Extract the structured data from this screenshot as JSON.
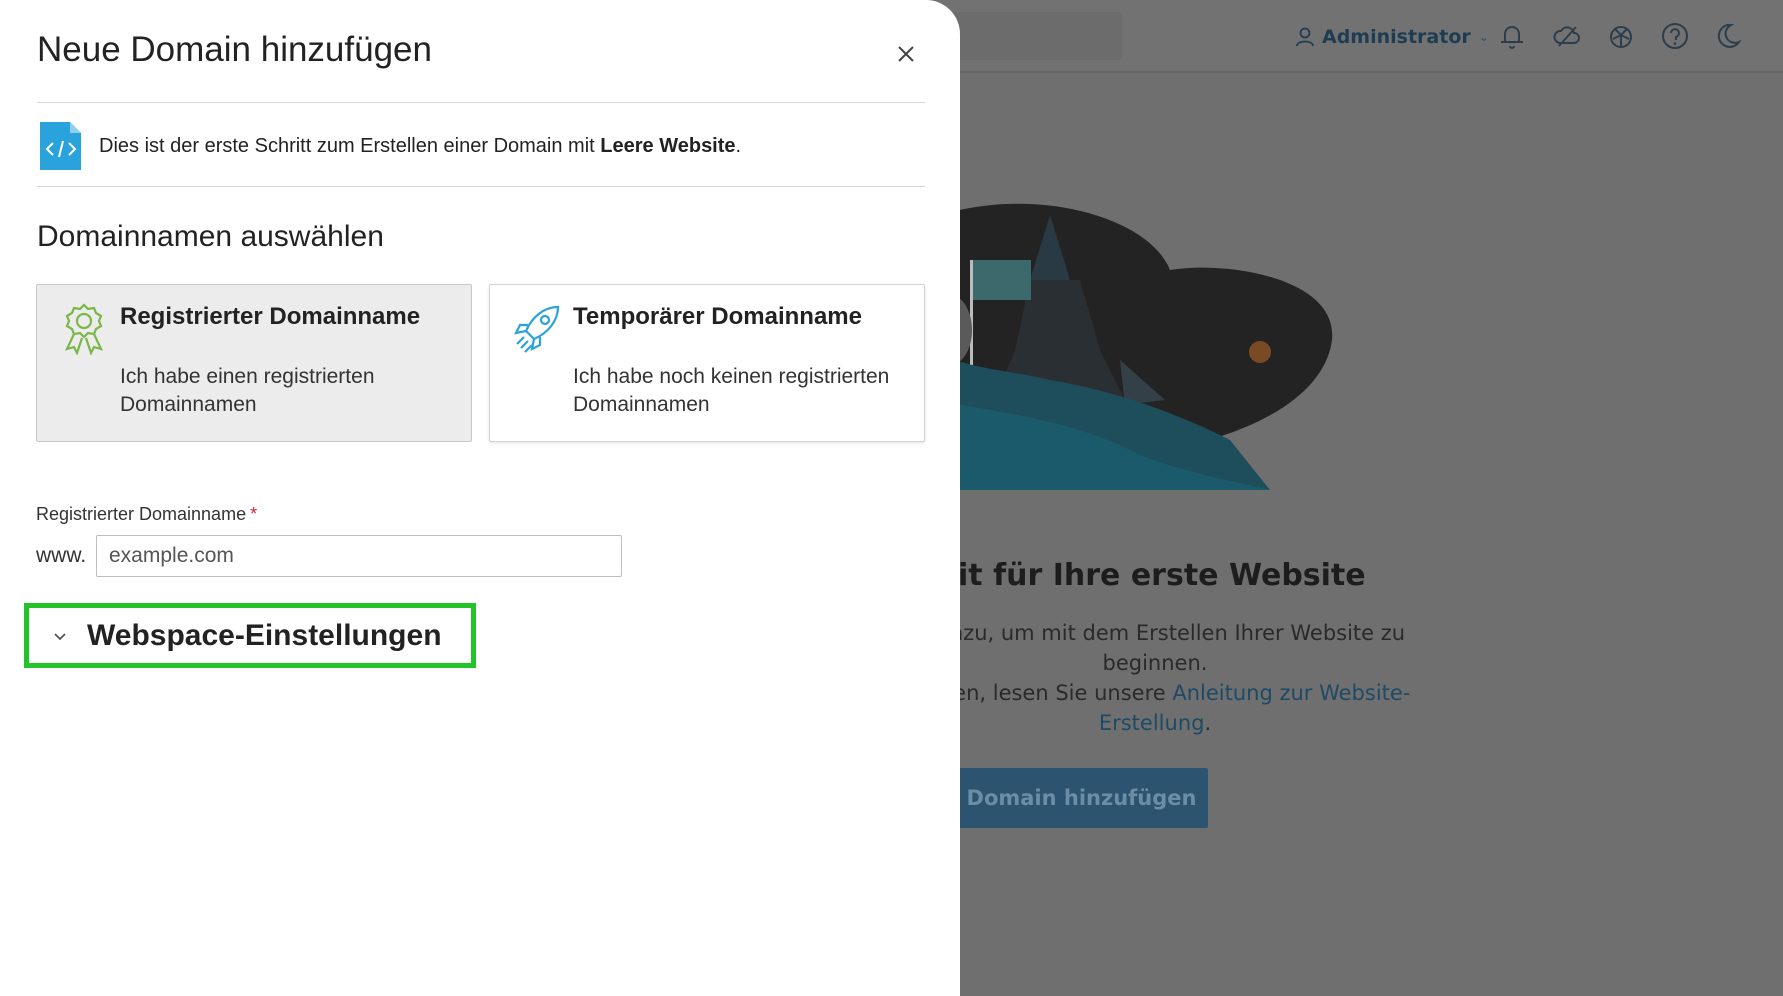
{
  "background": {
    "header": {
      "user_label": "Administrator"
    },
    "heading": "it für Ihre erste Website",
    "description_line1": "in hinzu, um mit dem Erstellen Ihrer Website zu beginnen.",
    "description_line2_prefix": "nötigen, lesen Sie unsere ",
    "description_link": "Anleitung zur Website-Erstellung",
    "description_line2_suffix": ".",
    "button_label": "Domain hinzufügen"
  },
  "dialog": {
    "title": "Neue Domain hinzufügen",
    "info_prefix": "Dies ist der erste Schritt zum Erstellen einer Domain mit ",
    "info_bold": "Leere Website",
    "info_suffix": ".",
    "section_title": "Domainnamen auswählen",
    "cards": [
      {
        "title": "Registrierter Domainname",
        "description": "Ich habe einen registrierten Domainnamen",
        "icon": "award-ribbon-icon",
        "selected": true
      },
      {
        "title": "Temporärer Domainname",
        "description": "Ich habe noch keinen registrierten Domainnamen",
        "icon": "rocket-icon",
        "selected": false
      }
    ],
    "field_label": "Registrierter Domainname",
    "required_marker": "*",
    "www_prefix": "www.",
    "domain_placeholder": "example.com",
    "webspace_label": "Webspace-Einstellungen"
  },
  "colors": {
    "highlight": "#22c42a",
    "required": "#d0233b",
    "icon_green": "#7ab648",
    "icon_blue": "#2aa3dc"
  }
}
